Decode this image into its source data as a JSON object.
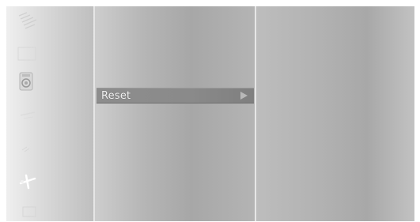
{
  "menu": {
    "items": [
      {
        "label": "Reset",
        "has_submenu": true,
        "selected": true
      }
    ]
  },
  "icons": [
    "satellite-icon",
    "picture-icon",
    "sound-icon",
    "channel-icon",
    "setup-icon",
    "installation-icon",
    "system-icon"
  ],
  "colors": {
    "highlight": "#8a8a8a",
    "label_text": "#f2f2f2"
  }
}
